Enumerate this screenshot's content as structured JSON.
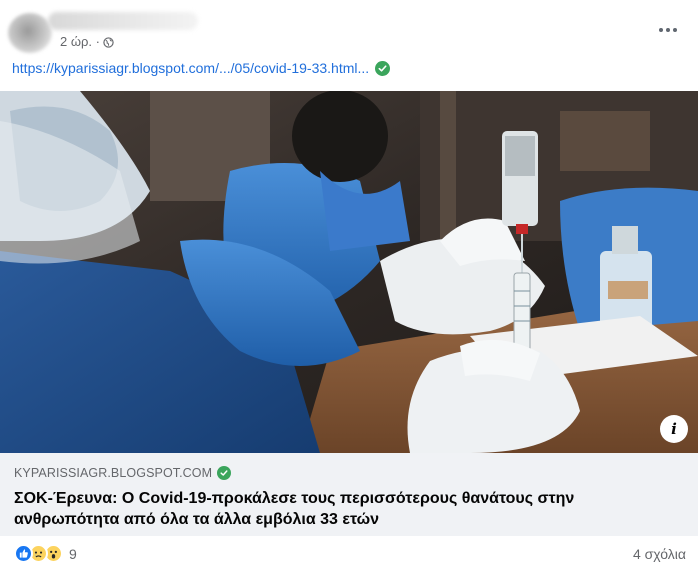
{
  "post": {
    "time": "2 ώρ. ·",
    "privacy_icon": "globe-icon",
    "menu_icon": "more-horizontal-icon",
    "link_text": "https://kyparissiagr.blogspot.com/.../05/covid-19-33.html...",
    "link_verified_icon": "verified-check-icon"
  },
  "preview": {
    "domain": "KYPARISSIAGR.BLOGSPOT.COM",
    "headline": "ΣΟΚ-Έρευνα: Ο Covid-19-προκάλεσε τους περισσότερους θανάτους στην ανθρωπότητα από όλα τα άλλα εμβόλια 33 ετών",
    "info_label": "i"
  },
  "footer": {
    "reactions": [
      "like",
      "sad",
      "wow"
    ],
    "reaction_count": "9",
    "comments": "4 σχόλια"
  },
  "colors": {
    "link": "#216fdb",
    "meta": "#65676b",
    "preview_bg": "#f0f2f5",
    "verified": "#3ba55c",
    "like": "#1877f2"
  }
}
